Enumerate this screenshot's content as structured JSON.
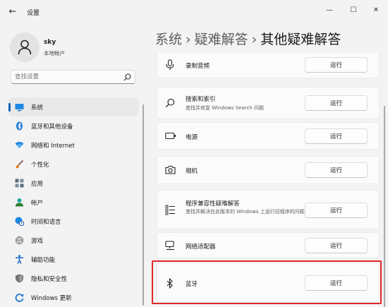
{
  "window": {
    "title": "设置",
    "back_glyph": "←",
    "minimize_glyph": "—",
    "maximize_glyph": "☐",
    "close_glyph": "✕"
  },
  "profile": {
    "name": "sky",
    "account_type": "本地帐户"
  },
  "search": {
    "placeholder": "查找设置",
    "value": ""
  },
  "breadcrumb": {
    "part1": "系统",
    "part2": "疑难解答",
    "current": "其他疑难解答",
    "separator": "›"
  },
  "sidebar": {
    "items": [
      {
        "label": "系统",
        "icon": "monitor-icon",
        "active": true
      },
      {
        "label": "蓝牙和其他设备",
        "icon": "bluetooth-devices-icon"
      },
      {
        "label": "网络和 Internet",
        "icon": "wifi-icon"
      },
      {
        "label": "个性化",
        "icon": "brush-icon"
      },
      {
        "label": "应用",
        "icon": "apps-icon"
      },
      {
        "label": "帐户",
        "icon": "account-icon"
      },
      {
        "label": "时间和语言",
        "icon": "globe-clock-icon"
      },
      {
        "label": "游戏",
        "icon": "xbox-icon"
      },
      {
        "label": "辅助功能",
        "icon": "accessibility-icon"
      },
      {
        "label": "隐私和安全性",
        "icon": "shield-icon"
      },
      {
        "label": "Windows 更新",
        "icon": "windows-update-icon"
      }
    ]
  },
  "troubleshooters": [
    {
      "title": "录制音频",
      "icon": "microphone-icon",
      "button": "运行"
    },
    {
      "title": "搜索和索引",
      "description": "查找并修复 Windows Search 问题",
      "icon": "search-icon",
      "button": "运行"
    },
    {
      "title": "电源",
      "icon": "battery-icon",
      "button": "运行"
    },
    {
      "title": "相机",
      "icon": "camera-icon",
      "button": "运行"
    },
    {
      "title": "程序兼容性疑难解答",
      "description": "查找并解决在此版本的 Windows 上运行旧程序的问题",
      "icon": "list-icon",
      "button": "运行"
    },
    {
      "title": "网络适配器",
      "icon": "network-adapter-icon",
      "button": "运行"
    },
    {
      "title": "蓝牙",
      "icon": "bluetooth-icon",
      "button": "运行",
      "highlighted": true
    }
  ],
  "colors": {
    "accent": "#005fb8",
    "highlight_border": "#e0262b",
    "background": "#f3f3f3",
    "card": "#fbfbfb"
  }
}
